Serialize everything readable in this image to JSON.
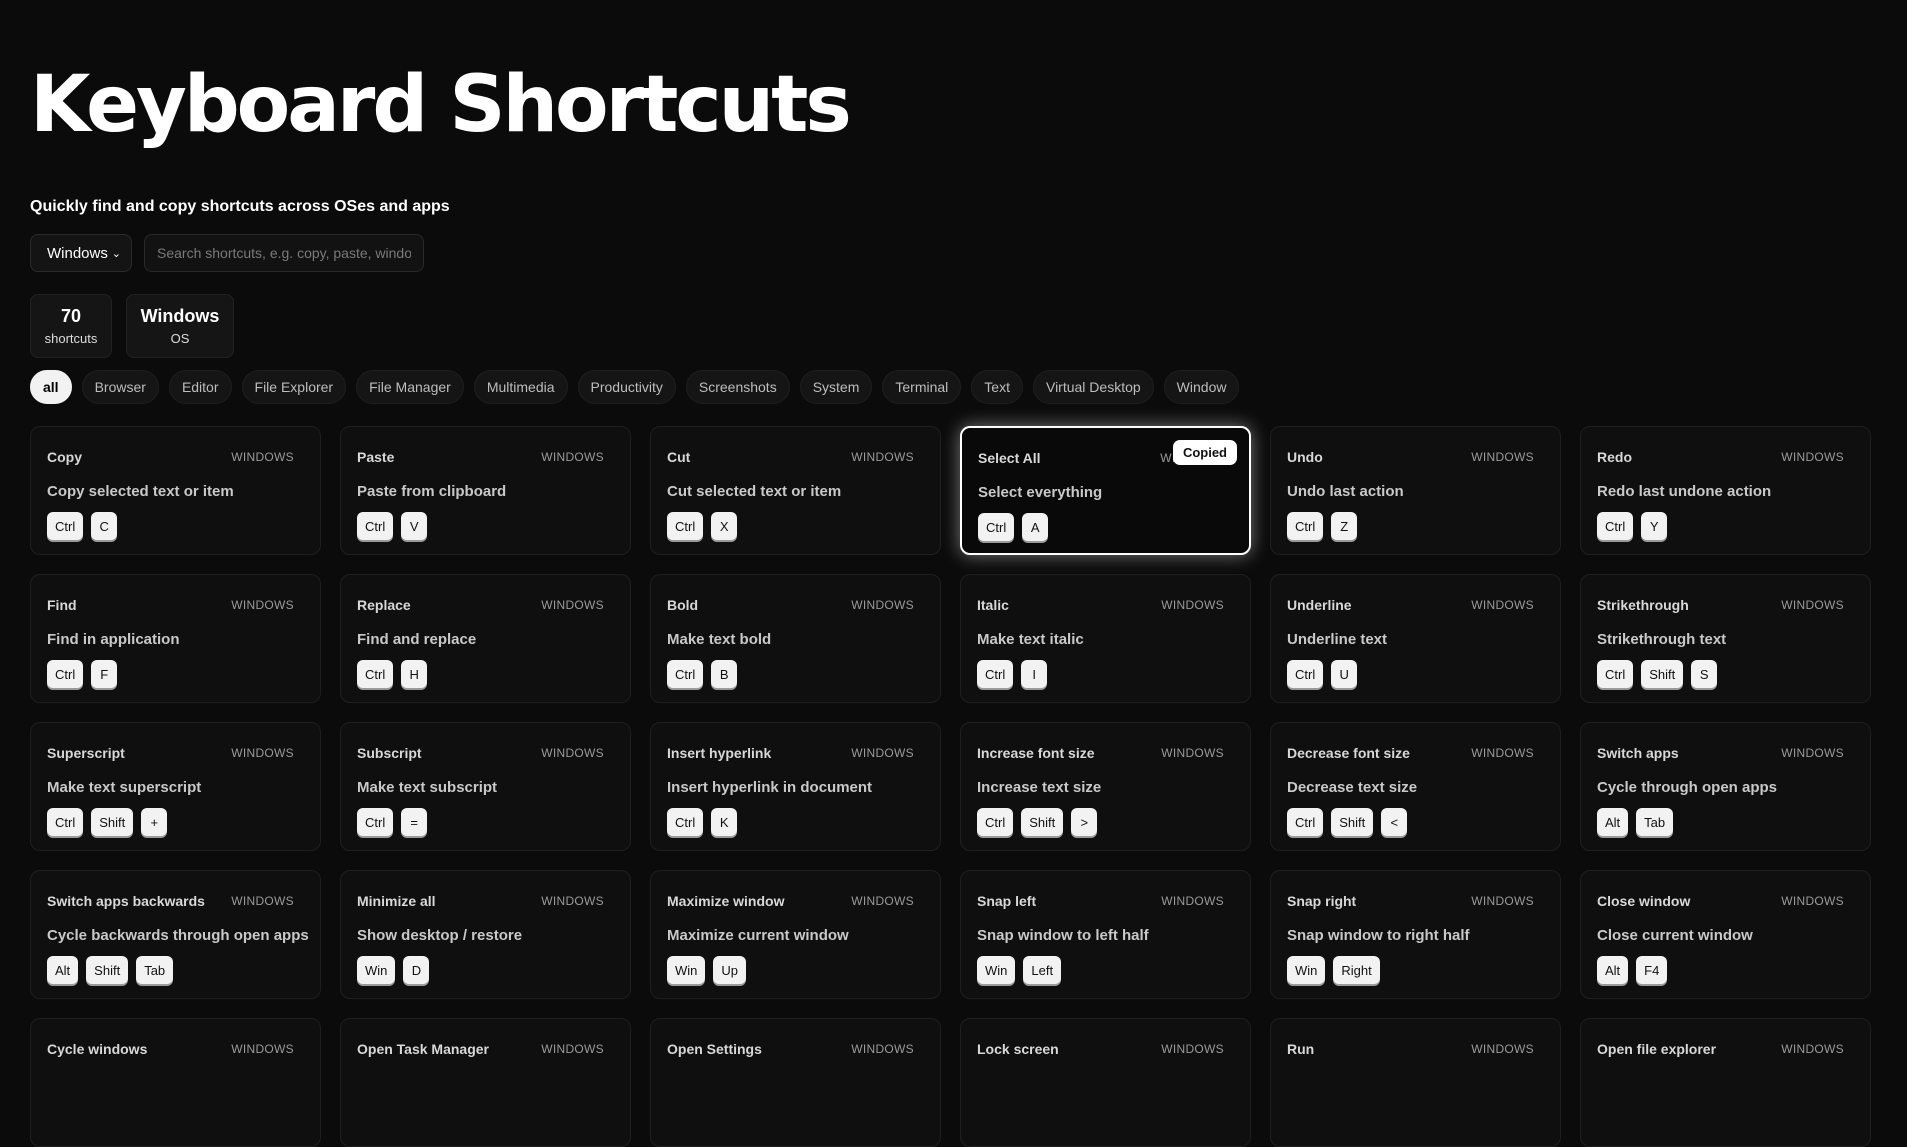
{
  "header": {
    "title": "Keyboard Shortcuts",
    "subtitle": "Quickly find and copy shortcuts across OSes and apps"
  },
  "controls": {
    "os_value": "Windows",
    "search_placeholder": "Search shortcuts, e.g. copy, paste, window"
  },
  "stats": [
    {
      "value": "70",
      "label": "shortcuts"
    },
    {
      "value": "Windows",
      "label": "OS"
    }
  ],
  "filters": [
    "all",
    "Browser",
    "Editor",
    "File Explorer",
    "File Manager",
    "Multimedia",
    "Productivity",
    "Screenshots",
    "System",
    "Terminal",
    "Text",
    "Virtual Desktop",
    "Window"
  ],
  "active_filter": "all",
  "copied_toast": "Copied",
  "cards": [
    {
      "name": "Copy",
      "os": "WINDOWS",
      "desc": "Copy selected text or item",
      "keys": [
        "Ctrl",
        "C"
      ]
    },
    {
      "name": "Paste",
      "os": "WINDOWS",
      "desc": "Paste from clipboard",
      "keys": [
        "Ctrl",
        "V"
      ]
    },
    {
      "name": "Cut",
      "os": "WINDOWS",
      "desc": "Cut selected text or item",
      "keys": [
        "Ctrl",
        "X"
      ]
    },
    {
      "name": "Select All",
      "os": "WINDOWS",
      "desc": "Select everything",
      "keys": [
        "Ctrl",
        "A"
      ],
      "copied": true
    },
    {
      "name": "Undo",
      "os": "WINDOWS",
      "desc": "Undo last action",
      "keys": [
        "Ctrl",
        "Z"
      ]
    },
    {
      "name": "Redo",
      "os": "WINDOWS",
      "desc": "Redo last undone action",
      "keys": [
        "Ctrl",
        "Y"
      ]
    },
    {
      "name": "Find",
      "os": "WINDOWS",
      "desc": "Find in application",
      "keys": [
        "Ctrl",
        "F"
      ]
    },
    {
      "name": "Replace",
      "os": "WINDOWS",
      "desc": "Find and replace",
      "keys": [
        "Ctrl",
        "H"
      ]
    },
    {
      "name": "Bold",
      "os": "WINDOWS",
      "desc": "Make text bold",
      "keys": [
        "Ctrl",
        "B"
      ]
    },
    {
      "name": "Italic",
      "os": "WINDOWS",
      "desc": "Make text italic",
      "keys": [
        "Ctrl",
        "I"
      ]
    },
    {
      "name": "Underline",
      "os": "WINDOWS",
      "desc": "Underline text",
      "keys": [
        "Ctrl",
        "U"
      ]
    },
    {
      "name": "Strikethrough",
      "os": "WINDOWS",
      "desc": "Strikethrough text",
      "keys": [
        "Ctrl",
        "Shift",
        "S"
      ]
    },
    {
      "name": "Superscript",
      "os": "WINDOWS",
      "desc": "Make text superscript",
      "keys": [
        "Ctrl",
        "Shift",
        "+"
      ]
    },
    {
      "name": "Subscript",
      "os": "WINDOWS",
      "desc": "Make text subscript",
      "keys": [
        "Ctrl",
        "="
      ]
    },
    {
      "name": "Insert hyperlink",
      "os": "WINDOWS",
      "desc": "Insert hyperlink in document",
      "keys": [
        "Ctrl",
        "K"
      ]
    },
    {
      "name": "Increase font size",
      "os": "WINDOWS",
      "desc": "Increase text size",
      "keys": [
        "Ctrl",
        "Shift",
        ">"
      ]
    },
    {
      "name": "Decrease font size",
      "os": "WINDOWS",
      "desc": "Decrease text size",
      "keys": [
        "Ctrl",
        "Shift",
        "<"
      ]
    },
    {
      "name": "Switch apps",
      "os": "WINDOWS",
      "desc": "Cycle through open apps",
      "keys": [
        "Alt",
        "Tab"
      ]
    },
    {
      "name": "Switch apps backwards",
      "os": "WINDOWS",
      "desc": "Cycle backwards through open apps",
      "keys": [
        "Alt",
        "Shift",
        "Tab"
      ]
    },
    {
      "name": "Minimize all",
      "os": "WINDOWS",
      "desc": "Show desktop / restore",
      "keys": [
        "Win",
        "D"
      ]
    },
    {
      "name": "Maximize window",
      "os": "WINDOWS",
      "desc": "Maximize current window",
      "keys": [
        "Win",
        "Up"
      ]
    },
    {
      "name": "Snap left",
      "os": "WINDOWS",
      "desc": "Snap window to left half",
      "keys": [
        "Win",
        "Left"
      ]
    },
    {
      "name": "Snap right",
      "os": "WINDOWS",
      "desc": "Snap window to right half",
      "keys": [
        "Win",
        "Right"
      ]
    },
    {
      "name": "Close window",
      "os": "WINDOWS",
      "desc": "Close current window",
      "keys": [
        "Alt",
        "F4"
      ]
    },
    {
      "name": "Cycle windows",
      "os": "WINDOWS",
      "desc": "",
      "keys": []
    },
    {
      "name": "Open Task Manager",
      "os": "WINDOWS",
      "desc": "",
      "keys": []
    },
    {
      "name": "Open Settings",
      "os": "WINDOWS",
      "desc": "",
      "keys": []
    },
    {
      "name": "Lock screen",
      "os": "WINDOWS",
      "desc": "",
      "keys": []
    },
    {
      "name": "Run",
      "os": "WINDOWS",
      "desc": "",
      "keys": []
    },
    {
      "name": "Open file explorer",
      "os": "WINDOWS",
      "desc": "",
      "keys": []
    }
  ]
}
